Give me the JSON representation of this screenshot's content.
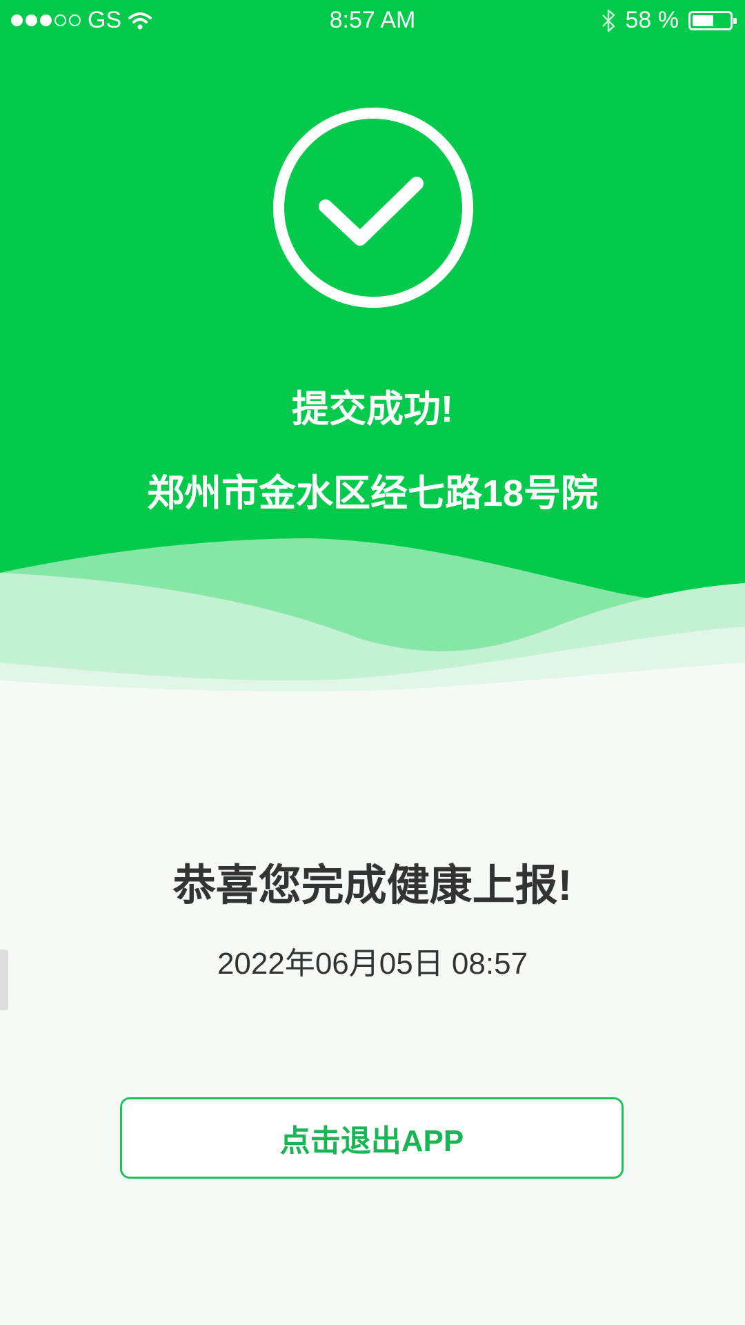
{
  "status_bar": {
    "carrier": "GS",
    "time": "8:57 AM",
    "battery_text": "58 %",
    "battery_level": 0.58,
    "signal_bars_filled": 3,
    "signal_bars_total": 5
  },
  "result": {
    "title": "提交成功!",
    "address": "郑州市金水区经七路18号院"
  },
  "report": {
    "congrats": "恭喜您完成健康上报!",
    "datetime": "2022年06月05日  08:57"
  },
  "actions": {
    "exit_label": "点击退出APP"
  },
  "colors": {
    "primary_green": "#03ca4a",
    "button_green": "#19b454",
    "text_dark": "#333333",
    "background": "#f5faf7"
  },
  "icons": {
    "status_icon": "check-circle-icon"
  }
}
